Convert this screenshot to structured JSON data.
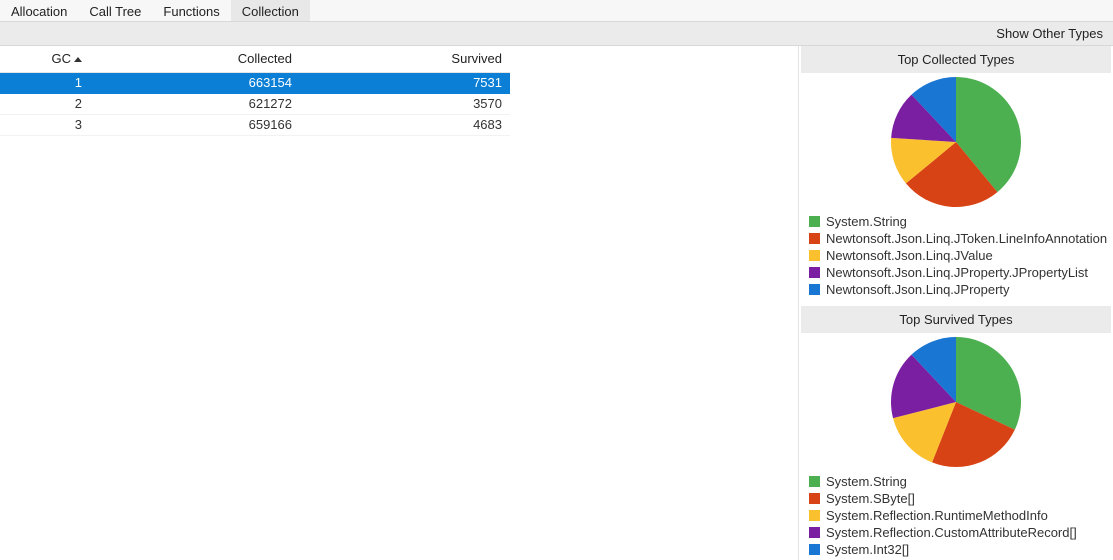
{
  "tabs": {
    "items": [
      {
        "label": "Allocation",
        "active": false
      },
      {
        "label": "Call Tree",
        "active": false
      },
      {
        "label": "Functions",
        "active": false
      },
      {
        "label": "Collection",
        "active": true
      }
    ]
  },
  "toolbar": {
    "show_other_types": "Show Other Types"
  },
  "table": {
    "columns": [
      {
        "label": "GC",
        "sorted": "asc"
      },
      {
        "label": "Collected",
        "sorted": null
      },
      {
        "label": "Survived",
        "sorted": null
      }
    ],
    "rows": [
      {
        "gc": "1",
        "collected": "663154",
        "survived": "7531",
        "selected": true
      },
      {
        "gc": "2",
        "collected": "621272",
        "survived": "3570",
        "selected": false
      },
      {
        "gc": "3",
        "collected": "659166",
        "survived": "4683",
        "selected": false
      }
    ]
  },
  "colors": [
    "#4caf50",
    "#d84315",
    "#fbc02d",
    "#7b1fa2",
    "#1976d2"
  ],
  "chart_data": [
    {
      "type": "pie",
      "title": "Top Collected Types",
      "series": [
        {
          "name": "System.String",
          "value": 39
        },
        {
          "name": "Newtonsoft.Json.Linq.JToken.LineInfoAnnotation",
          "value": 25
        },
        {
          "name": "Newtonsoft.Json.Linq.JValue",
          "value": 12
        },
        {
          "name": "Newtonsoft.Json.Linq.JProperty.JPropertyList",
          "value": 12
        },
        {
          "name": "Newtonsoft.Json.Linq.JProperty",
          "value": 12
        }
      ]
    },
    {
      "type": "pie",
      "title": "Top Survived Types",
      "series": [
        {
          "name": "System.String",
          "value": 32
        },
        {
          "name": "System.SByte[]",
          "value": 24
        },
        {
          "name": "System.Reflection.RuntimeMethodInfo",
          "value": 15
        },
        {
          "name": "System.Reflection.CustomAttributeRecord[]",
          "value": 17
        },
        {
          "name": "System.Int32[]",
          "value": 12
        }
      ]
    }
  ]
}
